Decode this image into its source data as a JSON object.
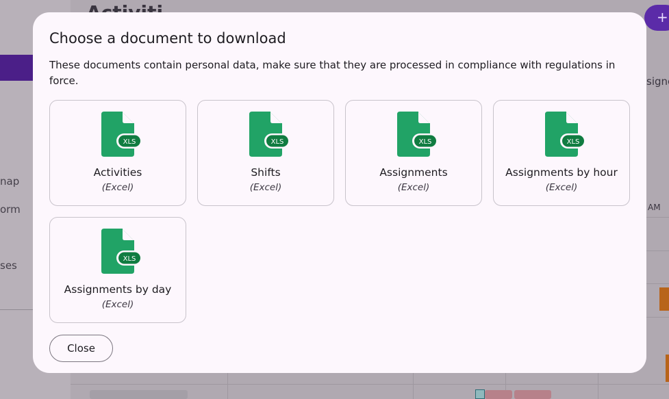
{
  "background": {
    "title": "Activiti",
    "fab_label": "+",
    "sidebar_items": [
      "nap",
      "orm",
      "ses"
    ],
    "right_text": "signe",
    "am_label": "AM"
  },
  "dialog": {
    "title": "Choose a document to download",
    "description": "These documents contain personal data, make sure that they are processed in compliance with regulations in force.",
    "file_badge": "XLS",
    "documents": [
      {
        "label": "Activities",
        "format": "(Excel)"
      },
      {
        "label": "Shifts",
        "format": "(Excel)"
      },
      {
        "label": "Assignments",
        "format": "(Excel)"
      },
      {
        "label": "Assignments by hour",
        "format": "(Excel)"
      },
      {
        "label": "Assignments by day",
        "format": "(Excel)"
      }
    ],
    "close_label": "Close"
  },
  "colors": {
    "accent": "#5b2ba8",
    "excel_green": "#21a366",
    "excel_dark": "#107c41",
    "dialog_bg": "#fdf7fd"
  }
}
